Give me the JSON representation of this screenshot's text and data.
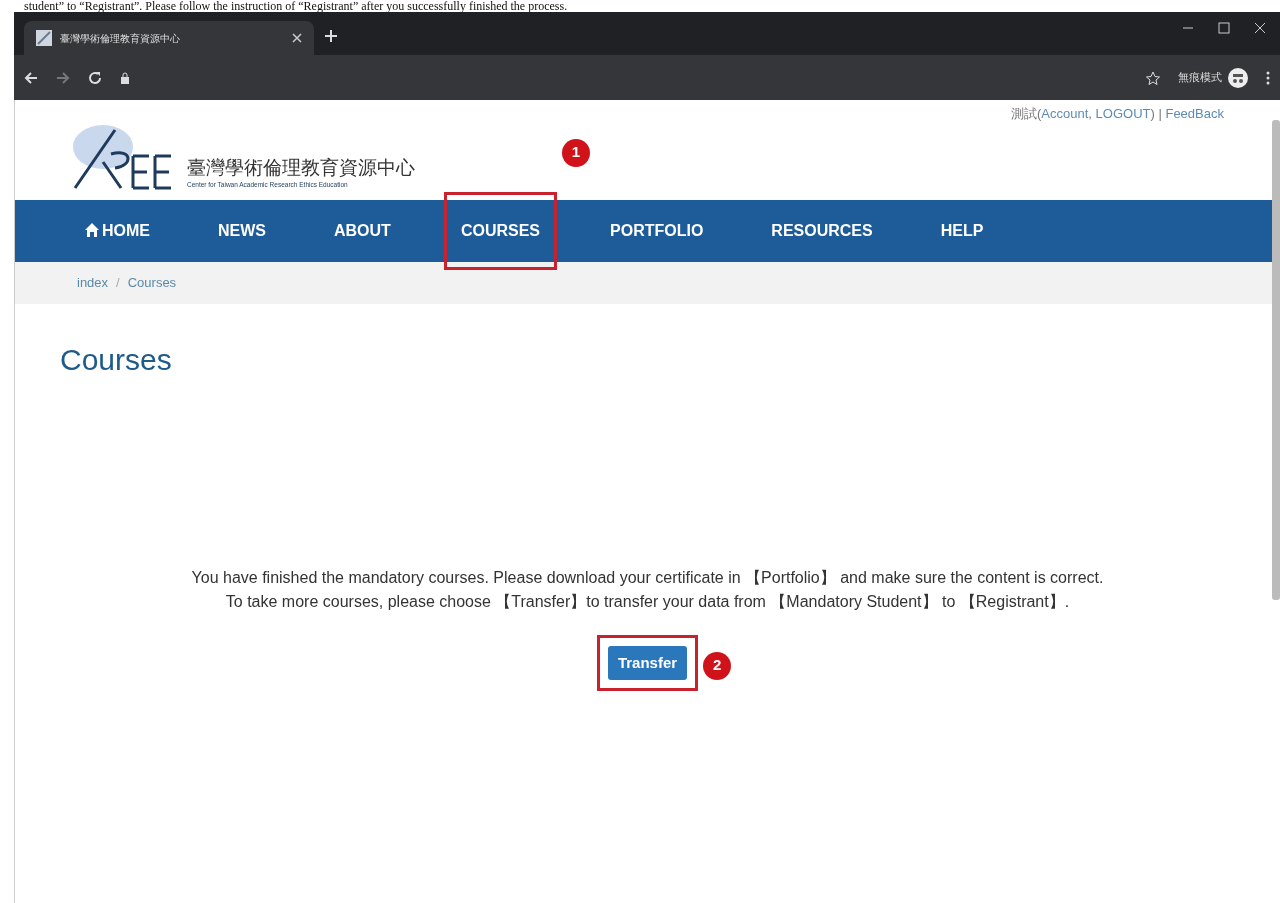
{
  "caption": "student” to “Registrant”. Please follow the instruction of “Registrant” after you successfully finished the process.",
  "browser": {
    "tab_title": "臺灣學術倫理教育資源中心",
    "mode_label": "無痕模式"
  },
  "top_links": [
    {
      "kind": "text",
      "text": "測試"
    },
    {
      "kind": "text",
      "text": "("
    },
    {
      "kind": "link",
      "text": "Account"
    },
    {
      "kind": "text",
      "text": ","
    },
    {
      "kind": "link",
      "text": "LOGOUT"
    },
    {
      "kind": "text",
      "text": ")"
    },
    {
      "kind": "text",
      "text": "|"
    },
    {
      "kind": "link",
      "text": "FeedBack"
    }
  ],
  "logo": {
    "title": "臺灣學術倫理教育資源中心",
    "subtitle": "Center for Taiwan Academic Research Ethics Education"
  },
  "nav": [
    {
      "label": "HOME",
      "kind": "home",
      "annotated": false
    },
    {
      "label": "NEWS",
      "kind": "plain",
      "annotated": false
    },
    {
      "label": "ABOUT",
      "kind": "plain",
      "annotated": false
    },
    {
      "label": "COURSES",
      "kind": "plain",
      "annotated": true,
      "marker": "1"
    },
    {
      "label": "PORTFOLIO",
      "kind": "plain",
      "annotated": false
    },
    {
      "label": "RESOURCES",
      "kind": "plain",
      "annotated": false
    },
    {
      "label": "HELP",
      "kind": "plain",
      "annotated": false
    }
  ],
  "breadcrumb": {
    "items": [
      "index",
      "Courses"
    ],
    "separator": "/"
  },
  "heading": "Courses",
  "message": [
    "You have finished the mandatory courses. Please download your certificate in 【Portfolio】 and make sure the content is correct.",
    "To take more courses, please choose 【Transfer】to transfer your data from 【Mandatory Student】 to 【Registrant】."
  ],
  "transfer_button": {
    "label": "Transfer",
    "annotated": true,
    "marker": "2"
  }
}
